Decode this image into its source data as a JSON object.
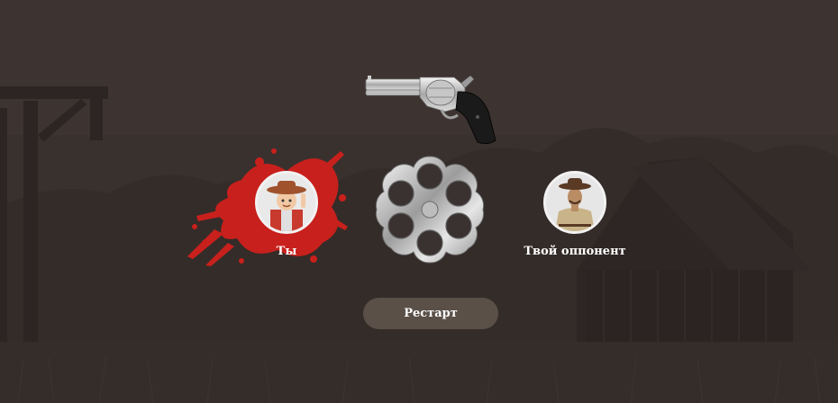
{
  "players": {
    "you": {
      "label": "Ты",
      "avatar": "child-cowboy-avatar",
      "status": "shot"
    },
    "opponent": {
      "label": "Твой оппонент",
      "avatar": "adult-cowboy-avatar"
    }
  },
  "revolver": {
    "icon": "revolver-icon"
  },
  "cylinder": {
    "icon": "revolver-cylinder-icon",
    "chambers": 6
  },
  "controls": {
    "restart_label": "Рестарт"
  },
  "colors": {
    "background": "#3a3230",
    "blood": "#c8201c",
    "button": "#5a5048",
    "text": "#ffffff"
  }
}
